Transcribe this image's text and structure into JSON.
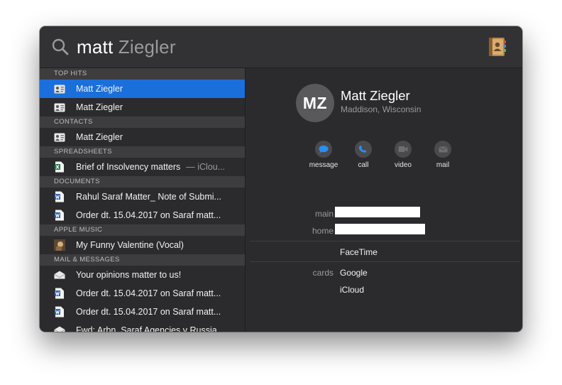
{
  "search": {
    "query": "matt",
    "completion": " Ziegler"
  },
  "results": {
    "top_hits": {
      "header": "TOP HITS",
      "items": [
        {
          "label": "Matt Ziegler",
          "selected": true
        },
        {
          "label": "Matt Ziegler"
        }
      ]
    },
    "contacts": {
      "header": "CONTACTS",
      "items": [
        {
          "label": "Matt Ziegler"
        }
      ]
    },
    "spreadsheets": {
      "header": "SPREADSHEETS",
      "items": [
        {
          "label": "Brief of Insolvency matters",
          "sub": "— iClou..."
        }
      ]
    },
    "documents": {
      "header": "DOCUMENTS",
      "items": [
        {
          "label": "Rahul Saraf Matter_ Note of Submi..."
        },
        {
          "label": "Order dt. 15.04.2017 on Saraf matt..."
        }
      ]
    },
    "apple_music": {
      "header": "APPLE MUSIC",
      "items": [
        {
          "label": "My Funny Valentine (Vocal)"
        }
      ]
    },
    "mail_messages": {
      "header": "MAIL & MESSAGES",
      "items": [
        {
          "label": "Your opinions matter to us!"
        },
        {
          "label": "Order dt. 15.04.2017 on Saraf matt..."
        },
        {
          "label": "Order dt. 15.04.2017 on Saraf matt..."
        },
        {
          "label": "Fwd: Arbn. Saraf Agencies v Russia..."
        }
      ]
    }
  },
  "contact": {
    "initials": "MZ",
    "name": "Matt Ziegler",
    "location": "Maddison, Wisconsin",
    "actions": {
      "message": "message",
      "call": "call",
      "video": "video",
      "mail": "mail"
    },
    "fields": {
      "main_label": "main",
      "home_label": "home",
      "facetime": "FaceTime",
      "cards_label": "cards",
      "card_google": "Google",
      "card_icloud": "iCloud"
    }
  },
  "colors": {
    "selection": "#1a6fdb",
    "panel": "#2b2b2d",
    "action_blue": "#2b8ef0"
  }
}
